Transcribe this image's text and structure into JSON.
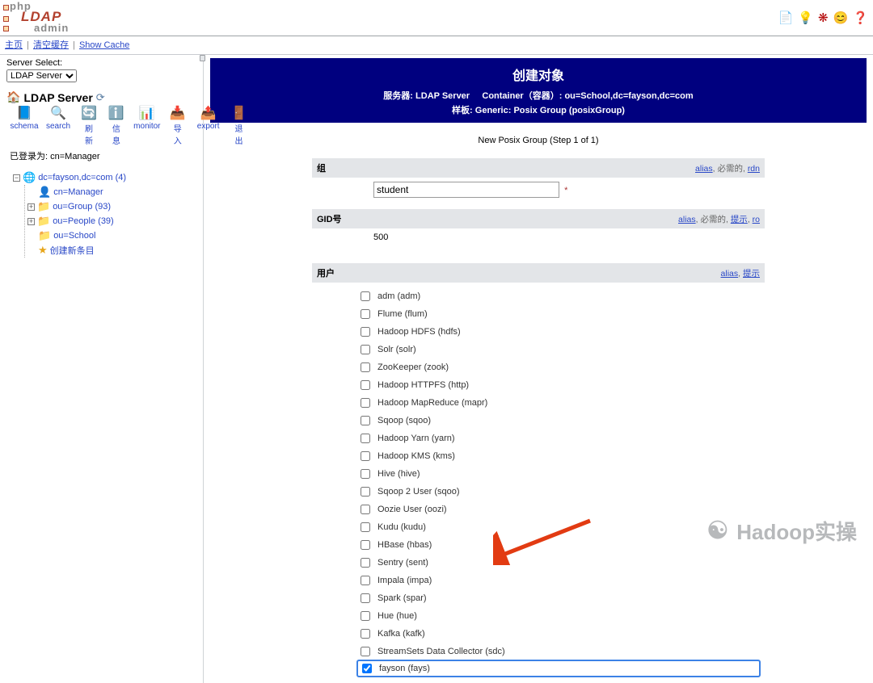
{
  "logo": {
    "line1": "php",
    "line2": "LDAP",
    "line3": "admin"
  },
  "topicons": {
    "request": "request-feature-icon",
    "bulb": "lightbulb-icon",
    "bug": "bug-icon",
    "smile": "donate-icon",
    "help": "help-icon"
  },
  "menubar": {
    "home": "主页",
    "purge": "清空缓存",
    "showcache": "Show Cache"
  },
  "server_select_label": "Server Select:",
  "server_select_value": "LDAP Server",
  "server_title": "LDAP Server",
  "toolbar": [
    {
      "id": "schema",
      "label": "schema",
      "icon": "📘"
    },
    {
      "id": "search",
      "label": "search",
      "icon": "🔍"
    },
    {
      "id": "refresh",
      "label": "刷新",
      "icon": "🔄"
    },
    {
      "id": "info",
      "label": "信息",
      "icon": "ℹ️"
    },
    {
      "id": "monitor",
      "label": "monitor",
      "icon": "📊"
    },
    {
      "id": "import",
      "label": "导入",
      "icon": "📥"
    },
    {
      "id": "export",
      "label": "export",
      "icon": "📤"
    },
    {
      "id": "logout",
      "label": "退出",
      "icon": "🚪"
    }
  ],
  "logged_in": "已登录为: cn=Manager",
  "tree": {
    "root": {
      "label": "dc=fayson,dc=com (4)"
    },
    "children": [
      {
        "id": "manager",
        "label": "cn=Manager",
        "expand": "",
        "icon": "👤",
        "iconClass": "ic-person"
      },
      {
        "id": "group",
        "label": "ou=Group (93)",
        "expand": "+",
        "icon": "📁",
        "iconClass": "ic-folder"
      },
      {
        "id": "people",
        "label": "ou=People (39)",
        "expand": "+",
        "icon": "📁",
        "iconClass": "ic-folder"
      },
      {
        "id": "school",
        "label": "ou=School",
        "expand": "",
        "icon": "📁",
        "iconClass": "ic-folder"
      },
      {
        "id": "create",
        "label": "创建新条目",
        "expand": "",
        "icon": "★",
        "iconClass": "ic-star"
      }
    ]
  },
  "page": {
    "title": "创建对象",
    "server_label": "服务器: ",
    "server_value": "LDAP Server",
    "container_label": "Container（容器）: ",
    "container_value": "ou=School,dc=fayson,dc=com",
    "template_label": "样板: ",
    "template_value": "Generic: Posix Group (posixGroup)",
    "step": "New Posix Group (Step 1 of 1)"
  },
  "form": {
    "group": {
      "header": "组",
      "hints": {
        "alias": "alias",
        "required": "必需的",
        "rdn": "rdn"
      },
      "value": "student",
      "required_mark": "*"
    },
    "gid": {
      "header": "GID号",
      "hints": {
        "alias": "alias",
        "required": "必需的",
        "hint": "提示",
        "ro": "ro"
      },
      "value": "500"
    },
    "users": {
      "header": "用户",
      "hints": {
        "alias": "alias",
        "hint": "提示"
      },
      "items": [
        {
          "label": "adm (adm)",
          "checked": false
        },
        {
          "label": "Flume (flum)",
          "checked": false
        },
        {
          "label": "Hadoop HDFS (hdfs)",
          "checked": false
        },
        {
          "label": "Solr (solr)",
          "checked": false
        },
        {
          "label": "ZooKeeper (zook)",
          "checked": false
        },
        {
          "label": "Hadoop HTTPFS (http)",
          "checked": false
        },
        {
          "label": "Hadoop MapReduce (mapr)",
          "checked": false
        },
        {
          "label": "Sqoop (sqoo)",
          "checked": false
        },
        {
          "label": "Hadoop Yarn (yarn)",
          "checked": false
        },
        {
          "label": "Hadoop KMS (kms)",
          "checked": false
        },
        {
          "label": "Hive (hive)",
          "checked": false
        },
        {
          "label": "Sqoop 2 User (sqoo)",
          "checked": false
        },
        {
          "label": "Oozie User (oozi)",
          "checked": false
        },
        {
          "label": "Kudu (kudu)",
          "checked": false
        },
        {
          "label": "HBase (hbas)",
          "checked": false
        },
        {
          "label": "Sentry (sent)",
          "checked": false
        },
        {
          "label": "Impala (impa)",
          "checked": false
        },
        {
          "label": "Spark (spar)",
          "checked": false
        },
        {
          "label": "Hue (hue)",
          "checked": false
        },
        {
          "label": "Kafka (kafk)",
          "checked": false
        },
        {
          "label": "StreamSets Data Collector (sdc)",
          "checked": false
        },
        {
          "label": "fayson (fays)",
          "checked": true,
          "highlight": true
        }
      ]
    }
  },
  "watermark": "Hadoop实操"
}
